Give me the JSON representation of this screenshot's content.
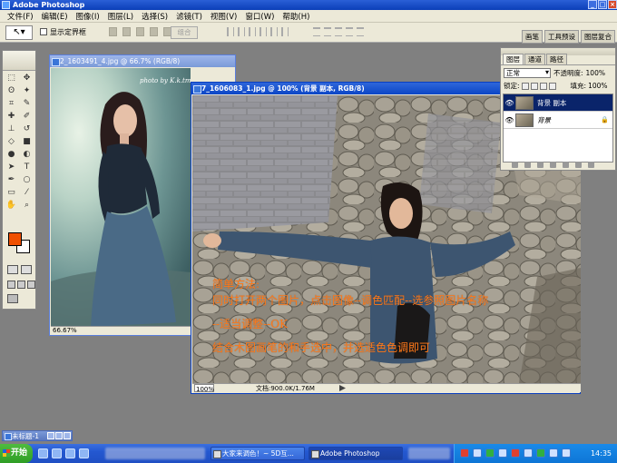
{
  "app": {
    "title": "Adobe Photoshop",
    "window_controls": [
      "_",
      "□",
      "×"
    ]
  },
  "menu": [
    "文件(F)",
    "编辑(E)",
    "图像(I)",
    "图层(L)",
    "选择(S)",
    "滤镜(T)",
    "视图(V)",
    "窗口(W)",
    "帮助(H)"
  ],
  "options_bar": {
    "tool_preset_glyph": "↖▾",
    "show_bounding_box_label": "显示定界框",
    "combine_label": "组合",
    "palette_tabs": [
      "画笔",
      "工具预设",
      "图层复合"
    ]
  },
  "toolbox": {
    "foreground_color": "#f05000",
    "background_color": "#ffffff"
  },
  "doc1": {
    "title": "2_1603491_4.jpg @ 66.7% (RGB/8)",
    "watermark": "photo by K.k.tm",
    "zoom": "66.67%"
  },
  "doc2": {
    "title": "7_1606083_1.jpg @ 100% (背景 副本, RGB/8)",
    "zoom": "100%",
    "doc_size": "文档:900.0K/1.76M",
    "overlay_lines": [
      "简单方法:",
      "同时打开两个图片，点击图像--调色匹配--选参照图片名称",
      "--适当调整--OK",
      "结合木图画笔的和手选中，并选适色色调即可"
    ]
  },
  "layers_panel": {
    "tabs": [
      "图层",
      "通道",
      "路径"
    ],
    "blend_mode": "正常",
    "opacity_label": "不透明度:",
    "opacity_value": "100%",
    "lock_label": "锁定:",
    "fill_label": "填充:",
    "fill_value": "100%",
    "layers": [
      {
        "name": "背景 副本",
        "selected": true
      },
      {
        "name": "背景",
        "selected": false
      }
    ]
  },
  "minimized_doc": {
    "title": "未标题-1"
  },
  "taskbar": {
    "start_label": "开始",
    "items": [
      {
        "label": "大家来调色！~ 5D互...",
        "active": false
      },
      {
        "label": "Adobe Photoshop",
        "active": true
      }
    ],
    "clock": "14:35"
  }
}
